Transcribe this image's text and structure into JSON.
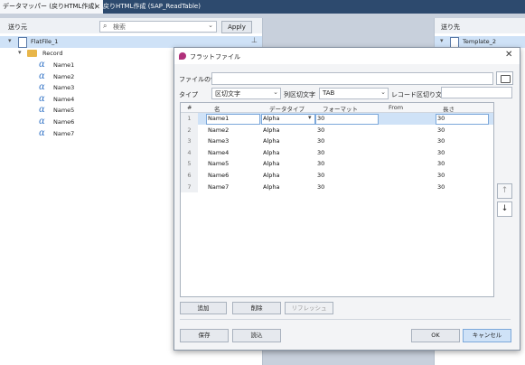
{
  "tabs": [
    {
      "label": "データマッパー (戻りHTML作成)",
      "active": true,
      "close": "✕"
    },
    {
      "label": "戻りHTML作成 (SAP_ReadTable)",
      "active": false
    }
  ],
  "left_panel": {
    "title": "送り元",
    "search_placeholder": "検索",
    "apply_label": "Apply",
    "root": "FlatFile_1",
    "record": "Record",
    "fields": [
      "Name1",
      "Name2",
      "Name3",
      "Name4",
      "Name5",
      "Name6",
      "Name7"
    ]
  },
  "right_panel": {
    "title": "送り先",
    "root": "Template_2"
  },
  "dialog": {
    "title": "フラットファイル",
    "close": "✕",
    "file_example_label": "ファイルの例",
    "type_label": "タイプ",
    "type_value": "区切文字",
    "col_delim_label": "列区切文字",
    "col_delim_value": "TAB",
    "record_delim_label": "レコード区切り文字",
    "columns": [
      "#",
      "名",
      "データタイプ",
      "フォーマット",
      "From",
      "長さ"
    ],
    "rows": [
      {
        "n": "1",
        "name": "Name1",
        "type": "Alpha",
        "format": "30",
        "from": "",
        "len": "30"
      },
      {
        "n": "2",
        "name": "Name2",
        "type": "Alpha",
        "format": "30",
        "from": "",
        "len": "30"
      },
      {
        "n": "3",
        "name": "Name3",
        "type": "Alpha",
        "format": "30",
        "from": "",
        "len": "30"
      },
      {
        "n": "4",
        "name": "Name4",
        "type": "Alpha",
        "format": "30",
        "from": "",
        "len": "30"
      },
      {
        "n": "5",
        "name": "Name5",
        "type": "Alpha",
        "format": "30",
        "from": "",
        "len": "30"
      },
      {
        "n": "6",
        "name": "Name6",
        "type": "Alpha",
        "format": "30",
        "from": "",
        "len": "30"
      },
      {
        "n": "7",
        "name": "Name7",
        "type": "Alpha",
        "format": "30",
        "from": "",
        "len": "30"
      }
    ],
    "buttons": {
      "add": "追加",
      "delete": "削除",
      "refresh": "リフレッシュ",
      "save": "保存",
      "load": "読込",
      "ok": "OK",
      "cancel": "キャンセル"
    }
  },
  "colors": {
    "accent": "#2d4a6e",
    "selection": "#cfe2f7",
    "icon_alpha": "#3a78c8"
  }
}
